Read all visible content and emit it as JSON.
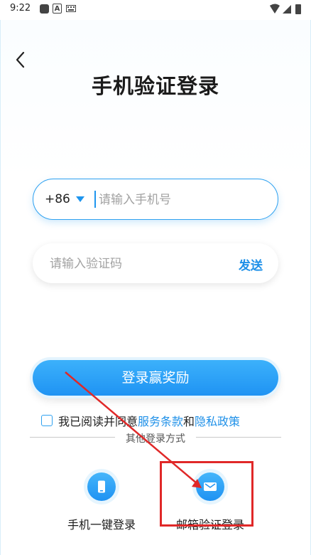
{
  "status_bar": {
    "time": "9:22",
    "keyboard_icon": "keyboard-icon",
    "wifi_icon": "wifi-icon",
    "battery_icon": "battery-icon"
  },
  "page": {
    "title": "手机验证登录"
  },
  "phone": {
    "country_code": "+86",
    "placeholder": "请输入手机号",
    "value": ""
  },
  "code": {
    "placeholder": "请输入验证码",
    "send_label": "发送"
  },
  "login_button": "登录赢奖励",
  "agreement": {
    "prefix": "我已阅读并同意",
    "terms": "服务条款",
    "and": "和",
    "privacy": "隐私政策"
  },
  "other_methods": {
    "heading": "其他登录方式",
    "options": [
      {
        "label": "手机一键登录",
        "icon": "phone-icon"
      },
      {
        "label": "邮箱验证登录",
        "icon": "mail-icon"
      }
    ]
  },
  "colors": {
    "accent": "#1e90e8",
    "annotation": "#e02828"
  }
}
